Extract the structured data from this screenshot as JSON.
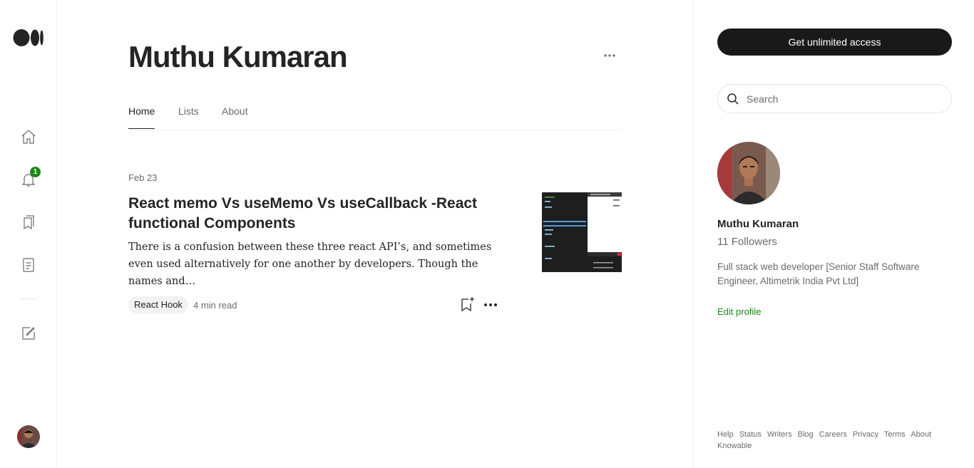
{
  "author": {
    "name": "Muthu Kumaran",
    "followers": "11 Followers",
    "bio": "Full stack web developer [Senior Staff Software Engineer, Altimetrik India Pvt Ltd]",
    "edit_profile": "Edit profile"
  },
  "tabs": [
    {
      "label": "Home",
      "active": true
    },
    {
      "label": "Lists",
      "active": false
    },
    {
      "label": "About",
      "active": false
    }
  ],
  "post": {
    "date": "Feb 23",
    "title": "React memo Vs useMemo Vs useCallback -React functional Components",
    "excerpt": "There is a confusion between these three react API’s, and sometimes even used alternatively for one another by developers. Though the names and…",
    "tag": "React Hook",
    "read_time": "4 min read"
  },
  "notifications_count": "1",
  "cta": "Get unlimited access",
  "search": {
    "placeholder": "Search"
  },
  "footer_links": [
    "Help",
    "Status",
    "Writers",
    "Blog",
    "Careers",
    "Privacy",
    "Terms",
    "About",
    "Knowable"
  ],
  "rail_icons": [
    "home-icon",
    "bell-icon",
    "library-icon",
    "stories-icon",
    "write-icon"
  ],
  "colors": {
    "accent": "#1a8917",
    "cta_bg": "#191919",
    "text": "#242424",
    "muted": "#6b6b6b"
  }
}
